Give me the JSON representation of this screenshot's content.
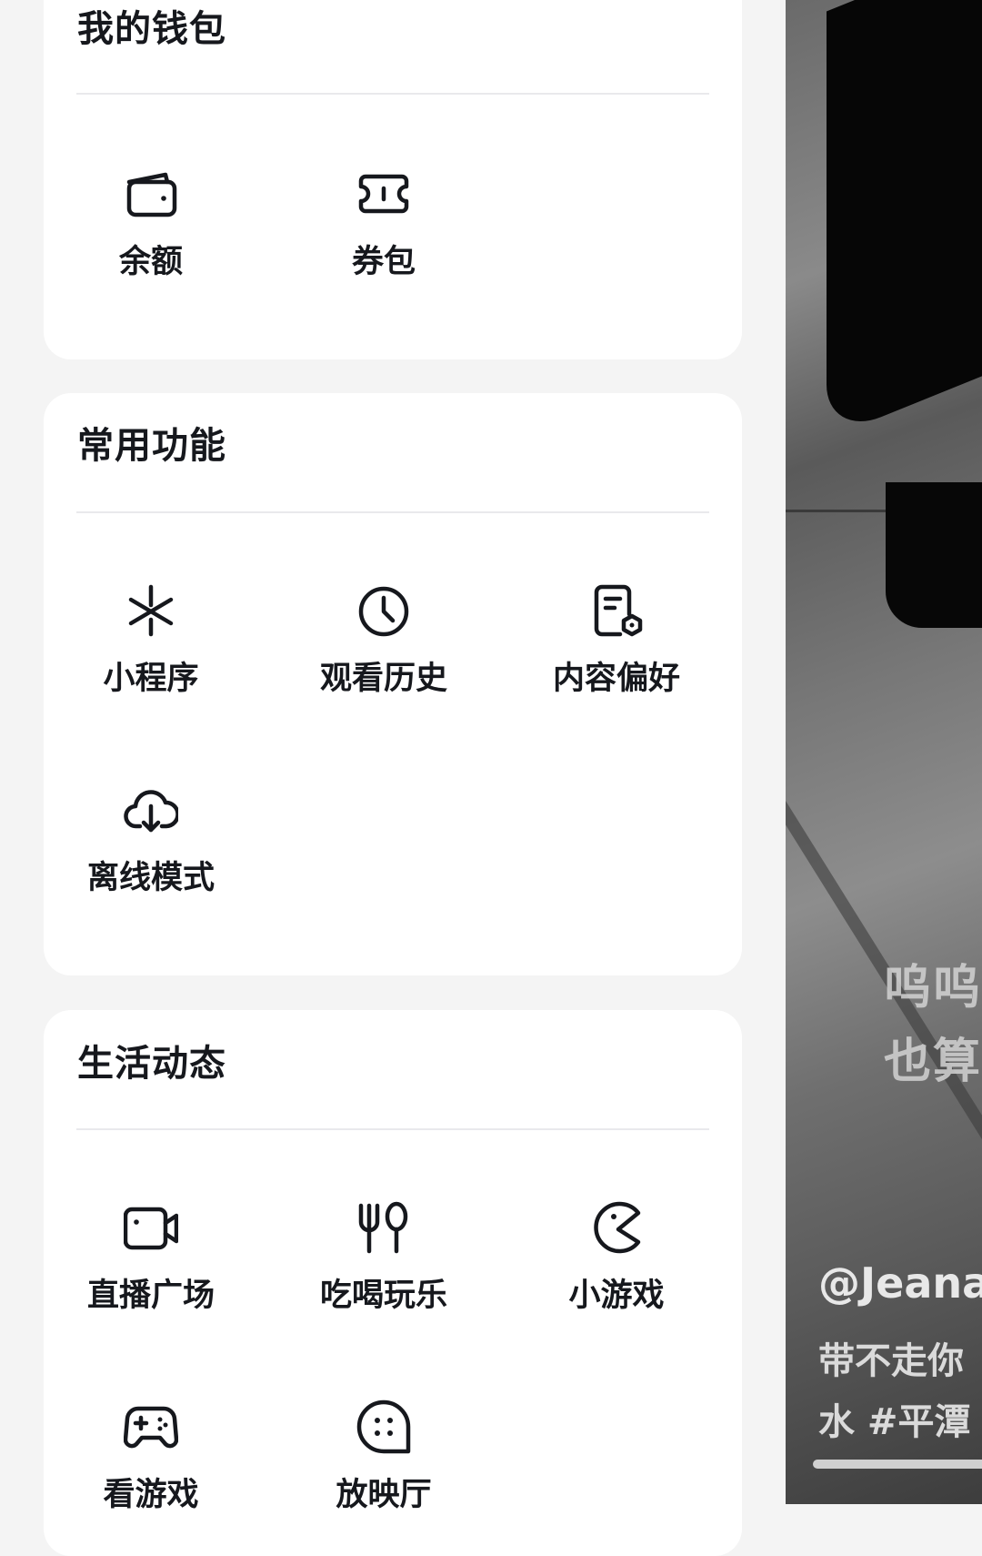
{
  "wallet": {
    "title": "我的钱包",
    "items": [
      {
        "label": "余额",
        "icon": "wallet-icon"
      },
      {
        "label": "券包",
        "icon": "ticket-icon"
      }
    ]
  },
  "common": {
    "title": "常用功能",
    "items": [
      {
        "label": "小程序",
        "icon": "mini-program-icon"
      },
      {
        "label": "观看历史",
        "icon": "clock-icon"
      },
      {
        "label": "内容偏好",
        "icon": "document-settings-icon"
      },
      {
        "label": "离线模式",
        "icon": "cloud-download-icon"
      }
    ]
  },
  "life": {
    "title": "生活动态",
    "items": [
      {
        "label": "直播广场",
        "icon": "video-camera-icon"
      },
      {
        "label": "吃喝玩乐",
        "icon": "fork-spoon-icon"
      },
      {
        "label": "小游戏",
        "icon": "pacman-icon"
      },
      {
        "label": "看游戏",
        "icon": "gamepad-icon"
      },
      {
        "label": "放映厅",
        "icon": "film-reel-icon"
      }
    ]
  },
  "video": {
    "caption_line1": "呜呜",
    "caption_line2": "也算",
    "author": "@Jeana",
    "desc_line1": "带不走你",
    "desc_line2": "水 #平潭"
  },
  "colors": {
    "background": "#f4f4f4",
    "card": "#ffffff",
    "text": "#16181d",
    "divider": "#e9e9ec"
  }
}
